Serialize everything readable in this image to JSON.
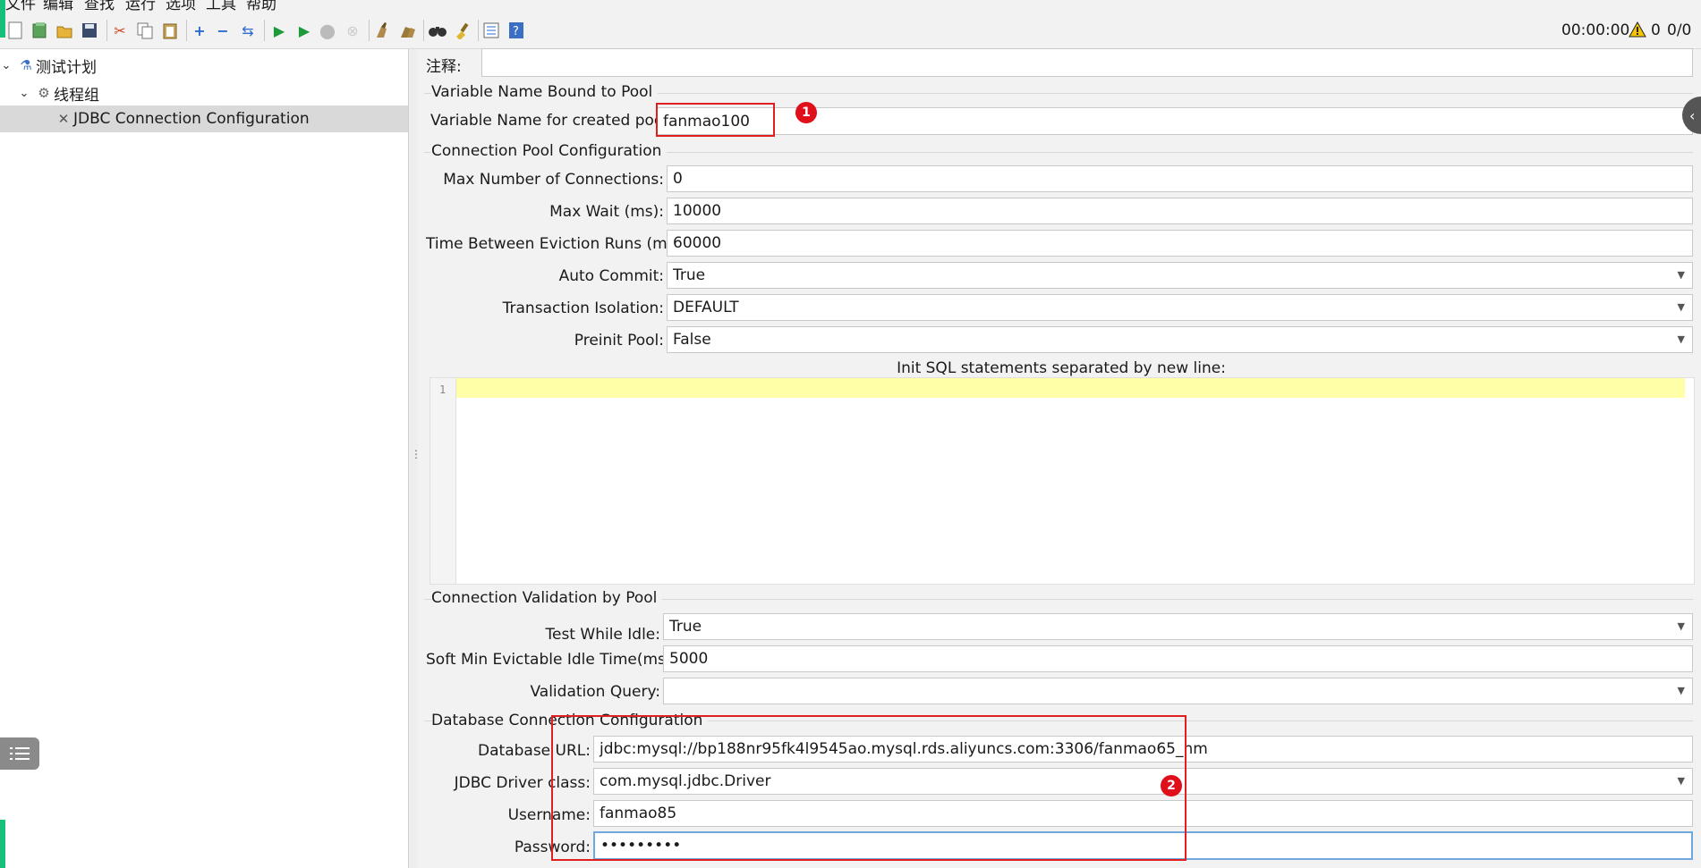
{
  "menu": [
    "文件",
    "编辑",
    "查找",
    "运行",
    "选项",
    "工具",
    "帮助"
  ],
  "toolbar": {
    "timer": "00:00:00",
    "warning_count": "0",
    "thread_ratio": "0/0"
  },
  "tree": {
    "items": [
      {
        "label": "测试计划",
        "icon": "flask-icon"
      },
      {
        "label": "线程组",
        "icon": "gear-icon"
      },
      {
        "label": "JDBC Connection Configuration",
        "icon": "wrench-icon"
      }
    ]
  },
  "form": {
    "comment_label": "注释:",
    "comment_value": "",
    "pool_section": "Variable Name Bound to Pool",
    "pool_var_label": "Variable Name for created pool:",
    "pool_var_value": "fanmao100",
    "conn_pool_section": "Connection Pool Configuration",
    "max_conn_label": "Max Number of Connections:",
    "max_conn_value": "0",
    "max_wait_label": "Max Wait (ms):",
    "max_wait_value": "10000",
    "eviction_label": "Time Between Eviction Runs (ms):",
    "eviction_value": "60000",
    "auto_commit_label": "Auto Commit:",
    "auto_commit_value": "True",
    "isolation_label": "Transaction Isolation:",
    "isolation_value": "DEFAULT",
    "preinit_label": "Preinit Pool:",
    "preinit_value": "False",
    "init_sql_label": "Init SQL statements separated by new line:",
    "line_number": "1",
    "validation_section": "Connection Validation by Pool",
    "test_idle_label": "Test While Idle:",
    "test_idle_value": "True",
    "soft_min_label": "Soft Min Evictable Idle Time(ms):",
    "soft_min_value": "5000",
    "validation_query_label": "Validation Query:",
    "validation_query_value": "",
    "db_section": "Database Connection Configuration",
    "db_url_label": "Database URL:",
    "db_url_value": "jdbc:mysql://bp188nr95fk4l9545ao.mysql.rds.aliyuncs.com:3306/fanmao65_hm",
    "driver_label": "JDBC Driver class:",
    "driver_value": "com.mysql.jdbc.Driver",
    "username_label": "Username:",
    "username_value": "fanmao85",
    "password_label": "Password:",
    "password_value": "•••••••••"
  },
  "annotations": [
    "1",
    "2"
  ],
  "colors": {
    "annotation_red": "#e02020",
    "editor_highlight": "#ffffa8",
    "accent_green": "#17c07a"
  }
}
